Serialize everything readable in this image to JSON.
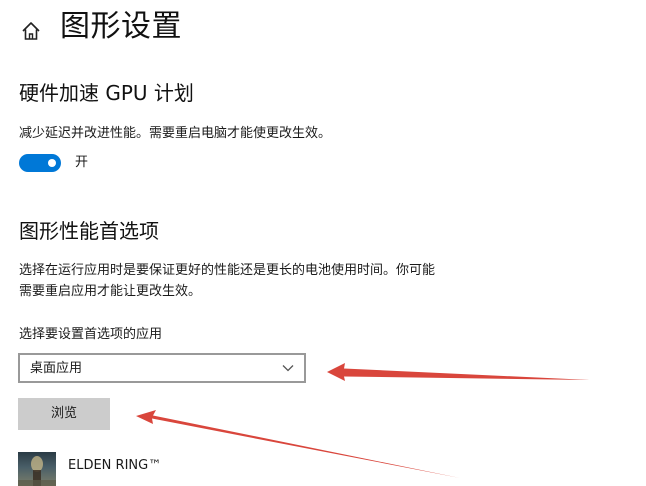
{
  "header": {
    "title": "图形设置",
    "home_icon": "home-icon"
  },
  "gpu_scheduling": {
    "title": "硬件加速 GPU 计划",
    "description": "减少延迟并改进性能。需要重启电脑才能使更改生效。",
    "toggle_state": "开",
    "toggle_on": true
  },
  "graphics_preference": {
    "title": "图形性能首选项",
    "description_line1": "选择在运行应用时是要保证更好的性能还是更长的电池使用时间。你可能",
    "description_line2": "需要重启应用才能让更改生效。",
    "select_label": "选择要设置首选项的应用",
    "select_value": "桌面应用",
    "browse_label": "浏览",
    "apps": [
      {
        "name": "ELDEN RING™"
      }
    ]
  },
  "colors": {
    "accent": "#0078d7",
    "annotation_arrow": "#d9463c",
    "button_bg": "#cccccc"
  }
}
